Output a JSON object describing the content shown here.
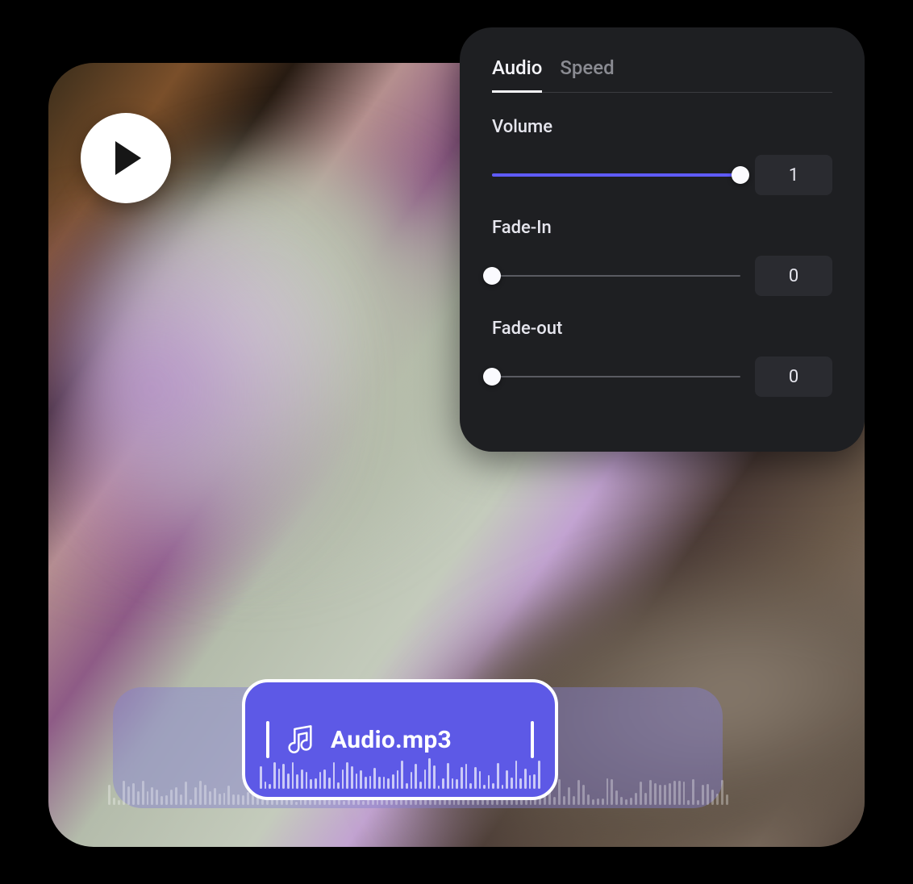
{
  "panel": {
    "tabs": [
      {
        "label": "Audio",
        "active": true
      },
      {
        "label": "Speed",
        "active": false
      }
    ],
    "controls": {
      "volume": {
        "label": "Volume",
        "value": "1",
        "percent": 100
      },
      "fade_in": {
        "label": "Fade-In",
        "value": "0",
        "percent": 0
      },
      "fade_out": {
        "label": "Fade-out",
        "value": "0",
        "percent": 0
      }
    }
  },
  "clip": {
    "filename": "Audio.mp3"
  },
  "colors": {
    "accent": "#5f5bff",
    "clip_bg": "#5d59e6",
    "panel_bg": "#1e1f22",
    "input_bg": "#2a2b30"
  },
  "icons": {
    "play": "play-icon",
    "music": "music-note-icon"
  }
}
